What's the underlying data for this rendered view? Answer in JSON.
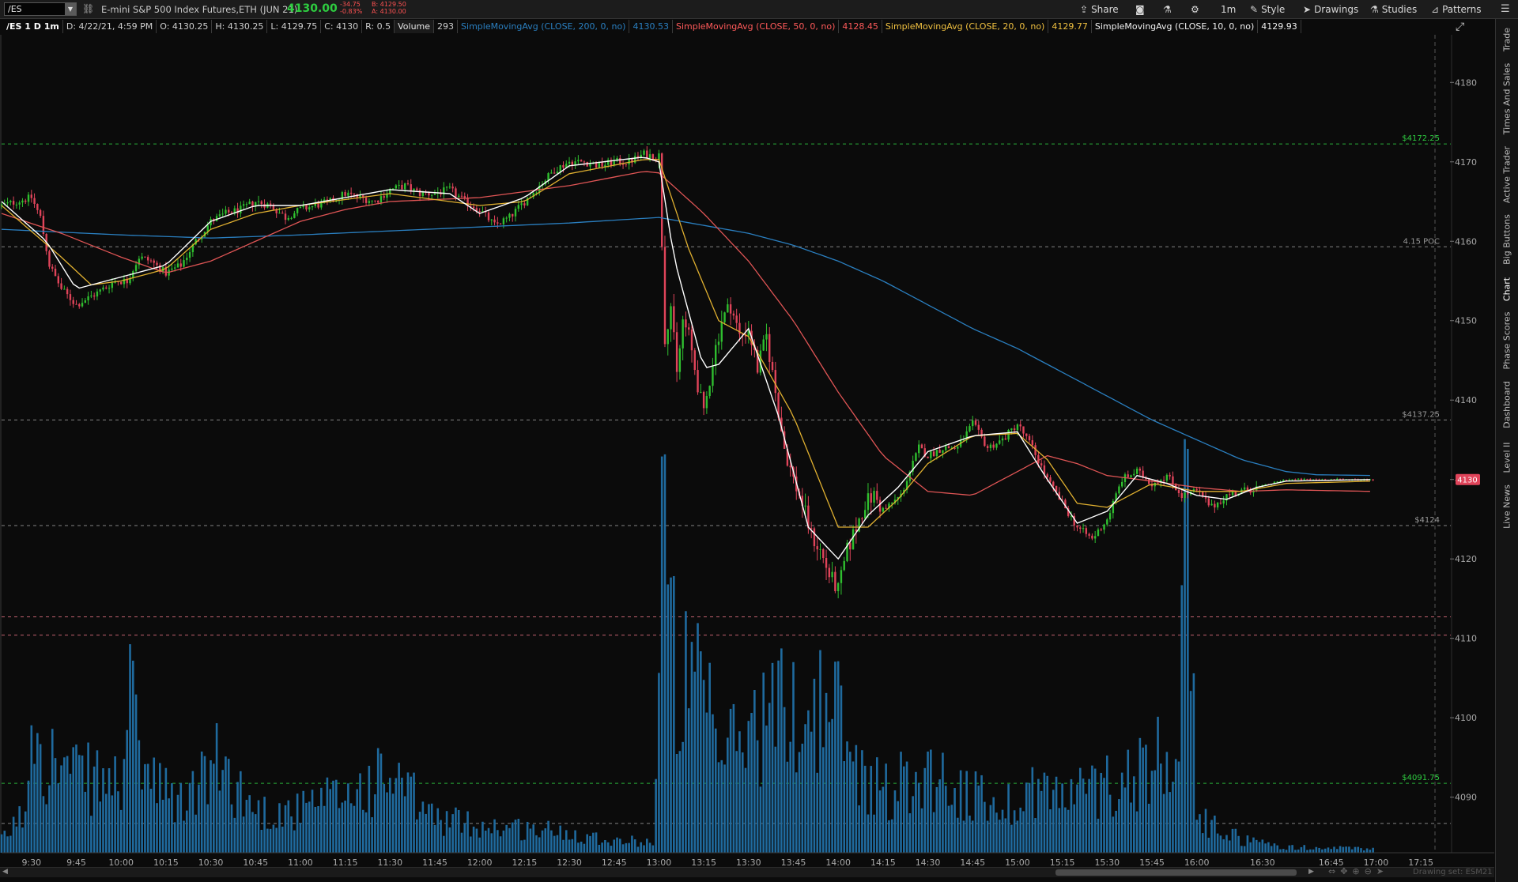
{
  "toolbar": {
    "symbol": "/ES",
    "instrument": "E-mini S&P 500 Index Futures,ETH (JUN 21)",
    "last_price": "4130.00",
    "net_change": "-34.75",
    "net_change_pct": "-0.83%",
    "bid": "B: 4129.50",
    "ask": "A: 4130.00",
    "buttons": {
      "share": "Share",
      "timeframe": "1m",
      "style": "Style",
      "drawings": "Drawings",
      "studies": "Studies",
      "patterns": "Patterns"
    }
  },
  "legend": {
    "chart_id": "/ES 1 D 1m",
    "datetime": "D: 4/22/21, 4:59 PM",
    "open": "O: 4130.25",
    "high": "H: 4130.25",
    "low": "L: 4129.75",
    "close": "C: 4130",
    "range": "R: 0.5",
    "volume_label": "Volume",
    "volume_value": "293",
    "sma200_label": "SimpleMovingAvg (CLOSE, 200, 0, no)",
    "sma200_value": "4130.53",
    "sma50_label": "SimpleMovingAvg (CLOSE, 50, 0, no)",
    "sma50_value": "4128.45",
    "sma20_label": "SimpleMovingAvg (CLOSE, 20, 0, no)",
    "sma20_value": "4129.77",
    "sma10_label": "SimpleMovingAvg (CLOSE, 10, 0, no)",
    "sma10_value": "4129.93"
  },
  "side_tabs": [
    "Trade",
    "Times And Sales",
    "Active Trader",
    "Big Buttons",
    "Chart",
    "Phase Scores",
    "Dashboard",
    "Level II",
    "Live News"
  ],
  "footer": {
    "drawing_set": "Drawing set: ESM21"
  },
  "colors": {
    "up": "#2fbf2f",
    "down": "#e0445a",
    "volume": "#1f6a9e",
    "sma200": "#2a7fc0",
    "sma50": "#e05555",
    "sma20": "#e0b030",
    "sma10": "#ffffff",
    "price_label_bg": "#e0445a"
  },
  "chart_data": {
    "type": "candlestick",
    "ylim": [
      4083,
      4186
    ],
    "y_ticks": [
      4090,
      4100,
      4110,
      4120,
      4130,
      4140,
      4150,
      4160,
      4170,
      4180
    ],
    "x_ticks": [
      "9:30",
      "9:45",
      "10:00",
      "10:15",
      "10:30",
      "10:45",
      "11:00",
      "11:15",
      "11:30",
      "11:45",
      "12:00",
      "12:15",
      "12:30",
      "12:45",
      "13:00",
      "13:15",
      "13:30",
      "13:45",
      "14:00",
      "14:15",
      "14:30",
      "14:45",
      "15:00",
      "15:15",
      "15:30",
      "15:45",
      "16:00",
      "16:30",
      "16:45",
      "17:00",
      "17:15"
    ],
    "current_price_label": "4130",
    "close_path": [
      [
        "9:20",
        4164.5
      ],
      [
        "9:30",
        4165.5
      ],
      [
        "9:33",
        4163
      ],
      [
        "9:36",
        4157
      ],
      [
        "9:40",
        4154
      ],
      [
        "9:45",
        4152
      ],
      [
        "9:52",
        4153.5
      ],
      [
        "9:58",
        4155
      ],
      [
        "10:02",
        4155
      ],
      [
        "10:06",
        4158
      ],
      [
        "10:10",
        4157.5
      ],
      [
        "10:15",
        4156
      ],
      [
        "10:20",
        4157
      ],
      [
        "10:25",
        4160
      ],
      [
        "10:30",
        4162.5
      ],
      [
        "10:35",
        4163.5
      ],
      [
        "10:40",
        4164
      ],
      [
        "10:45",
        4165
      ],
      [
        "10:50",
        4164.5
      ],
      [
        "10:55",
        4163
      ],
      [
        "11:00",
        4164
      ],
      [
        "11:05",
        4164.5
      ],
      [
        "11:10",
        4165
      ],
      [
        "11:15",
        4166
      ],
      [
        "11:20",
        4165.5
      ],
      [
        "11:25",
        4165
      ],
      [
        "11:30",
        4166.5
      ],
      [
        "11:35",
        4167
      ],
      [
        "11:40",
        4166
      ],
      [
        "11:45",
        4166
      ],
      [
        "11:50",
        4166.5
      ],
      [
        "11:55",
        4165
      ],
      [
        "12:00",
        4164
      ],
      [
        "12:05",
        4162
      ],
      [
        "12:10",
        4163
      ],
      [
        "12:15",
        4165
      ],
      [
        "12:20",
        4167
      ],
      [
        "12:25",
        4169
      ],
      [
        "12:30",
        4170
      ],
      [
        "12:35",
        4170
      ],
      [
        "12:40",
        4169.5
      ],
      [
        "12:45",
        4170
      ],
      [
        "12:50",
        4170
      ],
      [
        "12:55",
        4171
      ],
      [
        "13:00",
        4170.5
      ],
      [
        "13:01",
        4160
      ],
      [
        "13:02",
        4148
      ],
      [
        "13:04",
        4152
      ],
      [
        "13:06",
        4143
      ],
      [
        "13:08",
        4150
      ],
      [
        "13:10",
        4148
      ],
      [
        "13:12",
        4144
      ],
      [
        "13:15",
        4138
      ],
      [
        "13:18",
        4145
      ],
      [
        "13:21",
        4150
      ],
      [
        "13:24",
        4152
      ],
      [
        "13:27",
        4148
      ],
      [
        "13:30",
        4149
      ],
      [
        "13:33",
        4144
      ],
      [
        "13:36",
        4148
      ],
      [
        "13:39",
        4141
      ],
      [
        "13:42",
        4134
      ],
      [
        "13:45",
        4130
      ],
      [
        "13:48",
        4127
      ],
      [
        "13:51",
        4123
      ],
      [
        "13:54",
        4121
      ],
      [
        "13:57",
        4118
      ],
      [
        "14:00",
        4116
      ],
      [
        "14:03",
        4121
      ],
      [
        "14:06",
        4124
      ],
      [
        "14:09",
        4127
      ],
      [
        "14:12",
        4128
      ],
      [
        "14:15",
        4126
      ],
      [
        "14:18",
        4127
      ],
      [
        "14:21",
        4128
      ],
      [
        "14:24",
        4131
      ],
      [
        "14:27",
        4134
      ],
      [
        "14:30",
        4133
      ],
      [
        "14:35",
        4134
      ],
      [
        "14:40",
        4134
      ],
      [
        "14:45",
        4137
      ],
      [
        "14:50",
        4134
      ],
      [
        "14:55",
        4135
      ],
      [
        "15:00",
        4137
      ],
      [
        "15:05",
        4134
      ],
      [
        "15:10",
        4130
      ],
      [
        "15:15",
        4127
      ],
      [
        "15:20",
        4124
      ],
      [
        "15:25",
        4122.5
      ],
      [
        "15:30",
        4125
      ],
      [
        "15:35",
        4130
      ],
      [
        "15:40",
        4131
      ],
      [
        "15:45",
        4129.5
      ],
      [
        "15:50",
        4130.5
      ],
      [
        "15:55",
        4128
      ],
      [
        "16:00",
        4128.5
      ],
      [
        "16:05",
        4126.5
      ],
      [
        "16:10",
        4128
      ],
      [
        "16:15",
        4128.5
      ],
      [
        "16:20",
        4129
      ],
      [
        "16:25",
        4129.5
      ],
      [
        "16:30",
        4130
      ],
      [
        "16:40",
        4130
      ],
      [
        "16:50",
        4130
      ],
      [
        "16:59",
        4130
      ]
    ],
    "sma200_path": [
      [
        "9:20",
        4161.5
      ],
      [
        "10:00",
        4160.8
      ],
      [
        "10:30",
        4160.4
      ],
      [
        "11:00",
        4160.8
      ],
      [
        "11:30",
        4161.3
      ],
      [
        "12:00",
        4161.8
      ],
      [
        "12:30",
        4162.3
      ],
      [
        "13:00",
        4163
      ],
      [
        "13:15",
        4162
      ],
      [
        "13:30",
        4161
      ],
      [
        "13:45",
        4159.5
      ],
      [
        "14:00",
        4157.5
      ],
      [
        "14:15",
        4155
      ],
      [
        "14:30",
        4152
      ],
      [
        "14:45",
        4149
      ],
      [
        "15:00",
        4146.5
      ],
      [
        "15:15",
        4143.5
      ],
      [
        "15:30",
        4140.5
      ],
      [
        "15:45",
        4137.5
      ],
      [
        "16:00",
        4135
      ],
      [
        "16:15",
        4132.5
      ],
      [
        "16:30",
        4131
      ],
      [
        "16:40",
        4130.6
      ],
      [
        "16:59",
        4130.5
      ]
    ],
    "sma50_path": [
      [
        "9:20",
        4163.5
      ],
      [
        "9:40",
        4161
      ],
      [
        "10:00",
        4158
      ],
      [
        "10:15",
        4156
      ],
      [
        "10:30",
        4157.5
      ],
      [
        "10:45",
        4160
      ],
      [
        "11:00",
        4162.5
      ],
      [
        "11:15",
        4164
      ],
      [
        "11:30",
        4165
      ],
      [
        "12:00",
        4165.5
      ],
      [
        "12:30",
        4167
      ],
      [
        "12:55",
        4168.8
      ],
      [
        "13:00",
        4168.6
      ],
      [
        "13:15",
        4163.5
      ],
      [
        "13:30",
        4157.5
      ],
      [
        "13:45",
        4150
      ],
      [
        "14:00",
        4141
      ],
      [
        "14:15",
        4133
      ],
      [
        "14:30",
        4128.5
      ],
      [
        "14:45",
        4128
      ],
      [
        "15:00",
        4131
      ],
      [
        "15:10",
        4133
      ],
      [
        "15:20",
        4132
      ],
      [
        "15:30",
        4130.5
      ],
      [
        "15:45",
        4129.8
      ],
      [
        "16:00",
        4129
      ],
      [
        "16:15",
        4128.5
      ],
      [
        "16:30",
        4128.7
      ],
      [
        "16:59",
        4128.5
      ]
    ],
    "sma20_path": [
      [
        "9:20",
        4164.5
      ],
      [
        "9:40",
        4158
      ],
      [
        "9:50",
        4154.5
      ],
      [
        "10:00",
        4155
      ],
      [
        "10:15",
        4156.5
      ],
      [
        "10:30",
        4161.5
      ],
      [
        "10:45",
        4163.5
      ],
      [
        "11:00",
        4164.5
      ],
      [
        "11:30",
        4166
      ],
      [
        "12:00",
        4164.5
      ],
      [
        "12:15",
        4165
      ],
      [
        "12:30",
        4168.5
      ],
      [
        "12:55",
        4170.3
      ],
      [
        "13:00",
        4170.3
      ],
      [
        "13:10",
        4159
      ],
      [
        "13:20",
        4150
      ],
      [
        "13:30",
        4148
      ],
      [
        "13:45",
        4138
      ],
      [
        "14:00",
        4124
      ],
      [
        "14:10",
        4124
      ],
      [
        "14:20",
        4127.5
      ],
      [
        "14:30",
        4132
      ],
      [
        "14:45",
        4135.5
      ],
      [
        "15:00",
        4135.8
      ],
      [
        "15:10",
        4132.5
      ],
      [
        "15:20",
        4127
      ],
      [
        "15:30",
        4126.5
      ],
      [
        "15:45",
        4129.5
      ],
      [
        "16:00",
        4128.5
      ],
      [
        "16:15",
        4128.5
      ],
      [
        "16:30",
        4129.5
      ],
      [
        "16:59",
        4129.8
      ]
    ],
    "sma10_path": [
      [
        "9:20",
        4165
      ],
      [
        "9:35",
        4160
      ],
      [
        "9:45",
        4154
      ],
      [
        "10:00",
        4155.5
      ],
      [
        "10:15",
        4157
      ],
      [
        "10:30",
        4162.5
      ],
      [
        "10:45",
        4164.5
      ],
      [
        "11:00",
        4164.5
      ],
      [
        "11:30",
        4166.5
      ],
      [
        "11:50",
        4166
      ],
      [
        "12:00",
        4163.5
      ],
      [
        "12:15",
        4165.5
      ],
      [
        "12:30",
        4169.5
      ],
      [
        "12:55",
        4170.6
      ],
      [
        "13:00",
        4170
      ],
      [
        "13:05",
        4158
      ],
      [
        "13:15",
        4144
      ],
      [
        "13:20",
        4144.5
      ],
      [
        "13:30",
        4149
      ],
      [
        "13:40",
        4138
      ],
      [
        "13:50",
        4124
      ],
      [
        "14:00",
        4120
      ],
      [
        "14:10",
        4125.5
      ],
      [
        "14:20",
        4129
      ],
      [
        "14:30",
        4133.5
      ],
      [
        "14:45",
        4135.5
      ],
      [
        "15:00",
        4136
      ],
      [
        "15:10",
        4130
      ],
      [
        "15:20",
        4124.5
      ],
      [
        "15:30",
        4126
      ],
      [
        "15:40",
        4130.5
      ],
      [
        "15:50",
        4129.5
      ],
      [
        "16:00",
        4128
      ],
      [
        "16:10",
        4127.5
      ],
      [
        "16:20",
        4129
      ],
      [
        "16:30",
        4129.8
      ],
      [
        "16:59",
        4130
      ]
    ],
    "volume_path": [
      [
        "9:20",
        900
      ],
      [
        "9:28",
        3000
      ],
      [
        "9:30",
        11500
      ],
      [
        "9:35",
        7000
      ],
      [
        "9:45",
        5500
      ],
      [
        "10:00",
        5000
      ],
      [
        "10:02",
        11000
      ],
      [
        "10:10",
        5000
      ],
      [
        "10:20",
        3500
      ],
      [
        "10:30",
        6000
      ],
      [
        "10:33",
        6500
      ],
      [
        "10:45",
        3000
      ],
      [
        "11:00",
        3000
      ],
      [
        "11:30",
        5500
      ],
      [
        "11:45",
        2500
      ],
      [
        "12:00",
        2000
      ],
      [
        "12:30",
        1500
      ],
      [
        "12:45",
        900
      ],
      [
        "12:58",
        800
      ],
      [
        "13:00",
        12000
      ],
      [
        "13:01",
        26000
      ],
      [
        "13:03",
        17000
      ],
      [
        "13:06",
        13000
      ],
      [
        "13:10",
        12000
      ],
      [
        "13:15",
        11000
      ],
      [
        "13:20",
        7000
      ],
      [
        "13:30",
        9000
      ],
      [
        "13:40",
        10500
      ],
      [
        "13:50",
        10000
      ],
      [
        "13:55",
        11000
      ],
      [
        "14:00",
        10000
      ],
      [
        "14:05",
        6500
      ],
      [
        "14:15",
        4500
      ],
      [
        "14:30",
        6000
      ],
      [
        "14:45",
        4000
      ],
      [
        "15:00",
        3500
      ],
      [
        "15:05",
        5000
      ],
      [
        "15:15",
        4000
      ],
      [
        "15:30",
        5000
      ],
      [
        "15:45",
        6500
      ],
      [
        "15:52",
        9000
      ],
      [
        "15:55",
        14000
      ],
      [
        "15:57",
        26500
      ],
      [
        "15:58",
        15000
      ],
      [
        "16:00",
        2500
      ],
      [
        "16:15",
        1000
      ],
      [
        "16:30",
        400
      ],
      [
        "16:59",
        300
      ]
    ],
    "horizontal_levels": [
      {
        "label": "$4172.25",
        "value": 4172.25,
        "color": "#2ecc40",
        "style": "dashed"
      },
      {
        "label": "4.15 POC",
        "value": 4159.3,
        "color": "#999999",
        "style": "dashed"
      },
      {
        "label": "$4137.25",
        "value": 4137.5,
        "color": "#999999",
        "style": "dashed"
      },
      {
        "label": "$4124",
        "value": 4124.2,
        "color": "#999999",
        "style": "dashed"
      },
      {
        "label": "",
        "value": 4112.7,
        "color": "#e07080",
        "style": "dashed"
      },
      {
        "label": "",
        "value": 4110.4,
        "color": "#e07080",
        "style": "dashed"
      },
      {
        "label": "$4091.75",
        "value": 4091.75,
        "color": "#2ecc40",
        "style": "dashed"
      },
      {
        "label": "",
        "value": 4086.7,
        "color": "#999999",
        "style": "dashed"
      }
    ]
  }
}
